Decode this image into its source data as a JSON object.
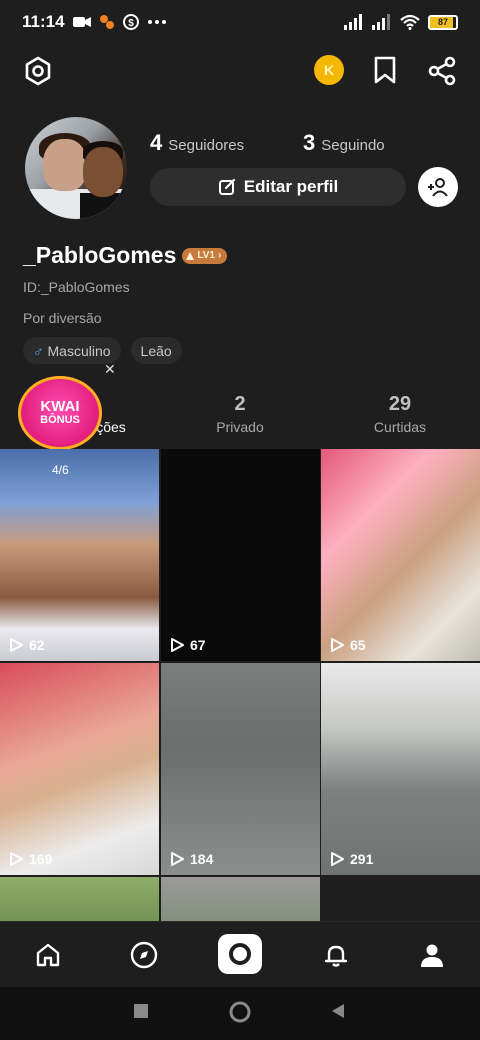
{
  "status_bar": {
    "time": "11:14",
    "battery": "87"
  },
  "profile": {
    "followers_count": "4",
    "followers_label": "Seguidores",
    "following_count": "3",
    "following_label": "Seguindo",
    "edit_label": "Editar perfil",
    "username": "_PabloGomes",
    "level": "LV1",
    "user_id": "ID:_PabloGomes",
    "bio": "Por diversão",
    "tags": [
      "Masculino",
      "Leão"
    ]
  },
  "bonus": {
    "line1": "KWAI",
    "line2": "BÔNUS"
  },
  "tabs": [
    {
      "count": "",
      "label": "ções"
    },
    {
      "count": "2",
      "label": "Privado"
    },
    {
      "count": "29",
      "label": "Curtidas"
    }
  ],
  "videos": [
    {
      "views": "62",
      "pinned": "4/6"
    },
    {
      "views": "67"
    },
    {
      "views": "65"
    },
    {
      "views": "169"
    },
    {
      "views": "184"
    },
    {
      "views": "291"
    }
  ],
  "icons": {
    "settings": "hexagon-settings-icon",
    "coin": "coin-icon",
    "bookmark": "bookmark-icon",
    "share": "share-icon",
    "add_friend": "add-friend-icon",
    "home": "home-icon",
    "discover": "compass-icon",
    "camera": "camera-icon",
    "notifications": "bell-icon",
    "profile": "person-icon"
  },
  "colors": {
    "background": "#1e1e1e",
    "level_badge": "#c77a3c",
    "coin": "#f5b800",
    "bonus": "#e01a7a"
  }
}
